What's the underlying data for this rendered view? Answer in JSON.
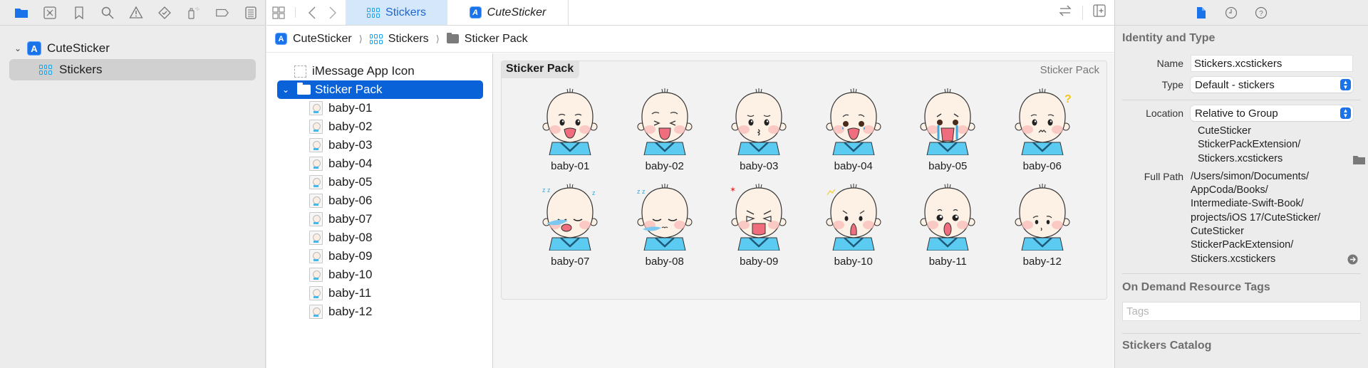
{
  "navigator": {
    "toolbar_icons": [
      "folder-icon",
      "source-control-icon",
      "bookmark-icon",
      "search-icon",
      "warning-icon",
      "test-icon",
      "debug-spray-icon",
      "breakpoint-icon",
      "report-icon"
    ],
    "project_name": "CuteSticker",
    "selected_item": "Stickers"
  },
  "editor": {
    "tabs": [
      {
        "label": "Stickers",
        "active": true
      },
      {
        "label": "CuteSticker",
        "active": false
      }
    ],
    "breadcrumb": [
      "CuteSticker",
      "Stickers",
      "Sticker Pack"
    ],
    "outline": {
      "app_icon_label": "iMessage App Icon",
      "pack_label": "Sticker Pack",
      "items": [
        "baby-01",
        "baby-02",
        "baby-03",
        "baby-04",
        "baby-05",
        "baby-06",
        "baby-07",
        "baby-08",
        "baby-09",
        "baby-10",
        "baby-11",
        "baby-12"
      ]
    },
    "pack": {
      "title": "Sticker Pack",
      "type_label": "Sticker Pack",
      "stickers": [
        {
          "name": "baby-01",
          "expression": "happy"
        },
        {
          "name": "baby-02",
          "expression": "tongue"
        },
        {
          "name": "baby-03",
          "expression": "kiss"
        },
        {
          "name": "baby-04",
          "expression": "teary"
        },
        {
          "name": "baby-05",
          "expression": "crying"
        },
        {
          "name": "baby-06",
          "expression": "confused"
        },
        {
          "name": "baby-07",
          "expression": "snoring"
        },
        {
          "name": "baby-08",
          "expression": "sleeping"
        },
        {
          "name": "baby-09",
          "expression": "angry"
        },
        {
          "name": "baby-10",
          "expression": "shocked"
        },
        {
          "name": "baby-11",
          "expression": "surprised"
        },
        {
          "name": "baby-12",
          "expression": "sad"
        }
      ]
    }
  },
  "inspector": {
    "tab_icons": [
      "file-icon",
      "history-icon",
      "help-icon"
    ],
    "identity": {
      "title": "Identity and Type",
      "name_label": "Name",
      "name_value": "Stickers.xcstickers",
      "type_label": "Type",
      "type_value": "Default - stickers",
      "location_label": "Location",
      "location_value": "Relative to Group",
      "location_path": [
        "CuteSticker",
        "StickerPackExtension/",
        "Stickers.xcstickers"
      ],
      "full_path_label": "Full Path",
      "full_path": [
        "/Users/simon/Documents/",
        "AppCoda/Books/",
        "Intermediate-Swift-Book/",
        "projects/iOS 17/CuteSticker/",
        "CuteSticker",
        "StickerPackExtension/",
        "Stickers.xcstickers"
      ]
    },
    "odr": {
      "title": "On Demand Resource Tags",
      "placeholder": "Tags"
    },
    "catalog": {
      "title": "Stickers Catalog"
    }
  },
  "colors": {
    "accent": "#0a62d8",
    "tab_active_bg": "#d4e7fb",
    "sticker_shirt": "#5ccbf2",
    "sticker_skin": "#fdf1e6"
  }
}
